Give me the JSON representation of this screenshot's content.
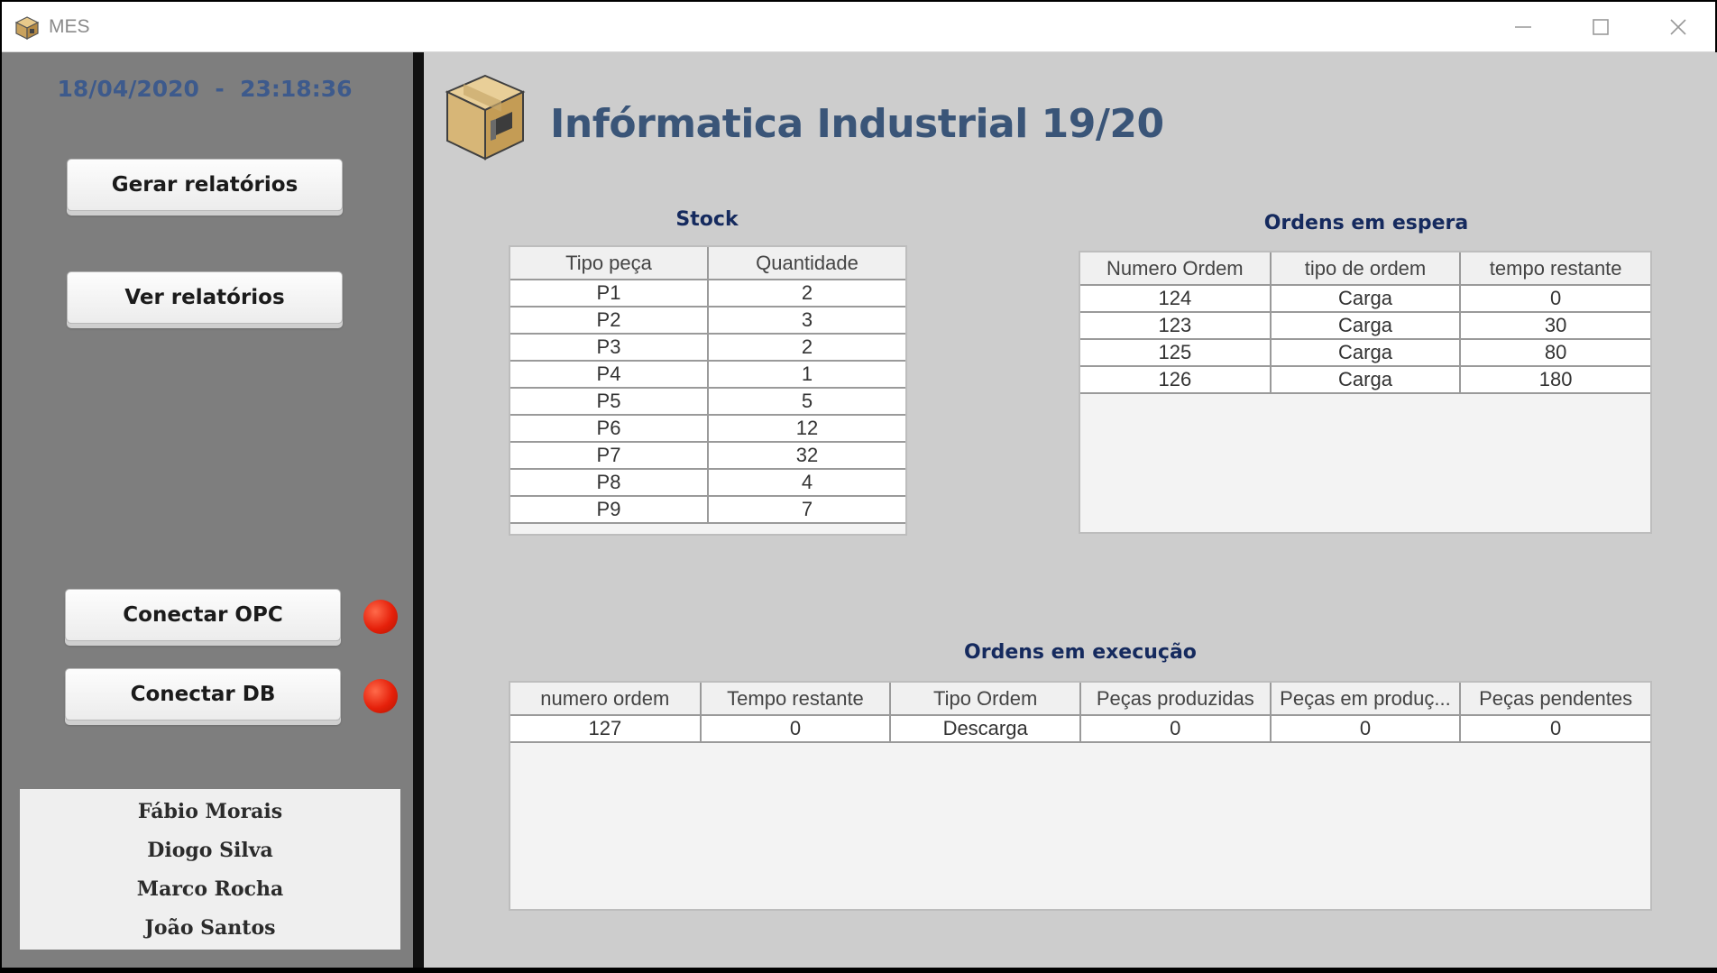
{
  "window": {
    "title": "MES"
  },
  "sidebar": {
    "datetime": "18/04/2020  -  23:18:36",
    "buttons": {
      "gerar": "Gerar relatórios",
      "ver": "Ver relatórios",
      "opc": "Conectar OPC",
      "db": "Conectar DB"
    },
    "status_colors": {
      "opc": "#e5200a",
      "db": "#e5200a"
    },
    "authors": [
      "Fábio Morais",
      "Diogo Silva",
      "Marco Rocha",
      "João Santos"
    ]
  },
  "main": {
    "title": "Infórmatica Industrial 19/20",
    "stock": {
      "title": "Stock",
      "columns": [
        "Tipo peça",
        "Quantidade"
      ],
      "rows": [
        [
          "P1",
          "2"
        ],
        [
          "P2",
          "3"
        ],
        [
          "P3",
          "2"
        ],
        [
          "P4",
          "1"
        ],
        [
          "P5",
          "5"
        ],
        [
          "P6",
          "12"
        ],
        [
          "P7",
          "32"
        ],
        [
          "P8",
          "4"
        ],
        [
          "P9",
          "7"
        ]
      ]
    },
    "espera": {
      "title": "Ordens em espera",
      "columns": [
        "Numero Ordem",
        "tipo de ordem",
        "tempo restante"
      ],
      "rows": [
        [
          "124",
          "Carga",
          "0"
        ],
        [
          "123",
          "Carga",
          "30"
        ],
        [
          "125",
          "Carga",
          "80"
        ],
        [
          "126",
          "Carga",
          "180"
        ]
      ]
    },
    "execucao": {
      "title": "Ordens em execução",
      "columns": [
        "numero ordem",
        "Tempo restante",
        "Tipo Ordem",
        "Peças produzidas",
        "Peças em produç...",
        "Peças pendentes"
      ],
      "rows": [
        [
          "127",
          "0",
          "Descarga",
          "0",
          "0",
          "0"
        ]
      ]
    }
  }
}
